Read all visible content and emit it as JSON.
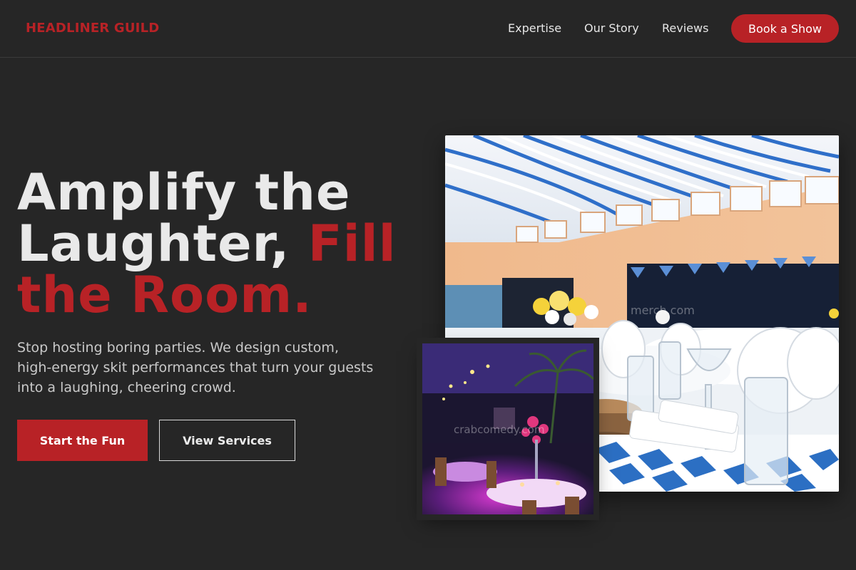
{
  "brand": "HEADLINER GUILD",
  "nav": {
    "links": [
      "Expertise",
      "Our Story",
      "Reviews"
    ],
    "cta": "Book a Show"
  },
  "hero": {
    "title_line1": "Amplify the",
    "title_line2": "Laughter,",
    "title_accent_1": "Fill",
    "title_accent_2": "the Room.",
    "subtitle": "Stop hosting boring parties. We design custom, high-energy skit performances that turn your guests into a laughing, cheering crowd.",
    "primary_button": "Start the Fun",
    "secondary_button": "View Services"
  },
  "images": {
    "main_watermark": "merch.com",
    "inset_watermark": "crabcomedy.com"
  },
  "colors": {
    "background": "#262626",
    "accent": "#b82226",
    "text": "#e9e9e9"
  }
}
